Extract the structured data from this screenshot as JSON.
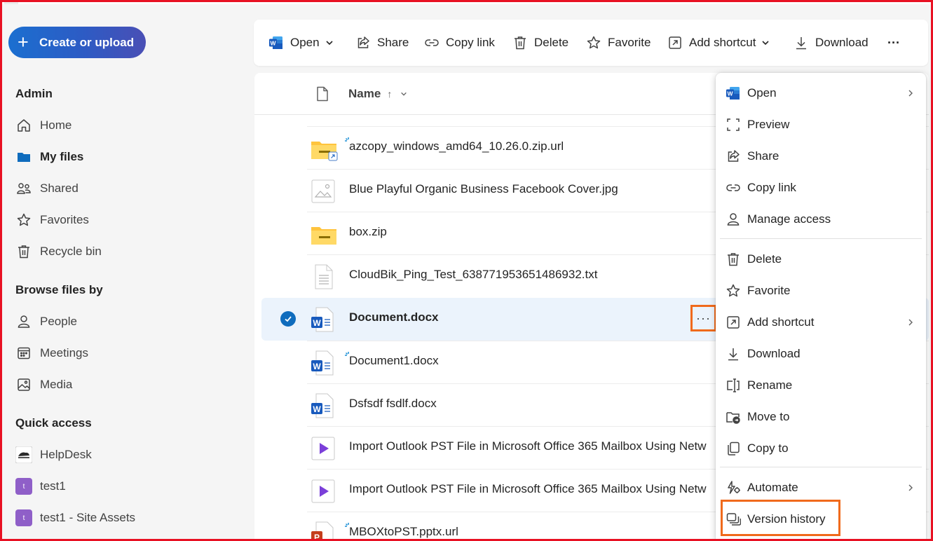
{
  "colors": {
    "accent": "#0f6cbd",
    "highlight": "#f06a1c",
    "frame": "#e81123"
  },
  "sidebar": {
    "create_label": "Create or upload",
    "sections": {
      "admin": "Admin",
      "browse": "Browse files by",
      "quick": "Quick access"
    },
    "admin_items": [
      {
        "label": "Home",
        "icon": "home-icon"
      },
      {
        "label": "My files",
        "icon": "folder-icon",
        "active": true
      },
      {
        "label": "Shared",
        "icon": "people-icon"
      },
      {
        "label": "Favorites",
        "icon": "star-icon"
      },
      {
        "label": "Recycle bin",
        "icon": "trash-icon"
      }
    ],
    "browse_items": [
      {
        "label": "People",
        "icon": "person-icon"
      },
      {
        "label": "Meetings",
        "icon": "calendar-icon"
      },
      {
        "label": "Media",
        "icon": "image-icon"
      }
    ],
    "quick_items": [
      {
        "label": "HelpDesk",
        "icon": "site-logo-icon"
      },
      {
        "label": "test1",
        "icon": "site-initial-icon",
        "initial": "t"
      },
      {
        "label": "test1 - Site Assets",
        "icon": "site-initial-icon",
        "initial": "t"
      }
    ]
  },
  "toolbar": {
    "open": "Open",
    "share": "Share",
    "copy_link": "Copy link",
    "delete": "Delete",
    "favorite": "Favorite",
    "add_shortcut": "Add shortcut",
    "download": "Download",
    "more": "···"
  },
  "list": {
    "header_name": "Name",
    "sort_arrow": "↑",
    "files": [
      {
        "name": "azcopy_windows_amd64_10.26.0.zip.url",
        "type": "zip-shortcut"
      },
      {
        "name": "Blue Playful Organic Business Facebook Cover.jpg",
        "type": "image"
      },
      {
        "name": "box.zip",
        "type": "zip"
      },
      {
        "name": "CloudBik_Ping_Test_638771953651486932.txt",
        "type": "text"
      },
      {
        "name": "Document.docx",
        "type": "word",
        "selected": true
      },
      {
        "name": "Document1.docx",
        "type": "word"
      },
      {
        "name": "Dsfsdf fsdlf.docx",
        "type": "word"
      },
      {
        "name": "Import Outlook PST File in Microsoft Office 365 Mailbox Using Netw",
        "type": "video"
      },
      {
        "name": "Import Outlook PST File in Microsoft Office 365 Mailbox Using Netw",
        "type": "video"
      },
      {
        "name": "MBOXtoPST.pptx.url",
        "type": "powerpoint"
      }
    ],
    "more_label": "···"
  },
  "menu": {
    "items": [
      {
        "label": "Open",
        "icon": "word-icon",
        "submenu": true
      },
      {
        "label": "Preview",
        "icon": "preview-icon"
      },
      {
        "label": "Share",
        "icon": "share-icon"
      },
      {
        "label": "Copy link",
        "icon": "link-icon"
      },
      {
        "label": "Manage access",
        "icon": "person-icon"
      },
      {
        "label": "Delete",
        "icon": "trash-icon"
      },
      {
        "label": "Favorite",
        "icon": "star-icon"
      },
      {
        "label": "Add shortcut",
        "icon": "shortcut-icon",
        "submenu": true
      },
      {
        "label": "Download",
        "icon": "download-icon"
      },
      {
        "label": "Rename",
        "icon": "rename-icon"
      },
      {
        "label": "Move to",
        "icon": "move-icon"
      },
      {
        "label": "Copy to",
        "icon": "copy-icon"
      },
      {
        "label": "Automate",
        "icon": "automate-icon",
        "submenu": true
      },
      {
        "label": "Version history",
        "icon": "version-history-icon"
      }
    ]
  }
}
